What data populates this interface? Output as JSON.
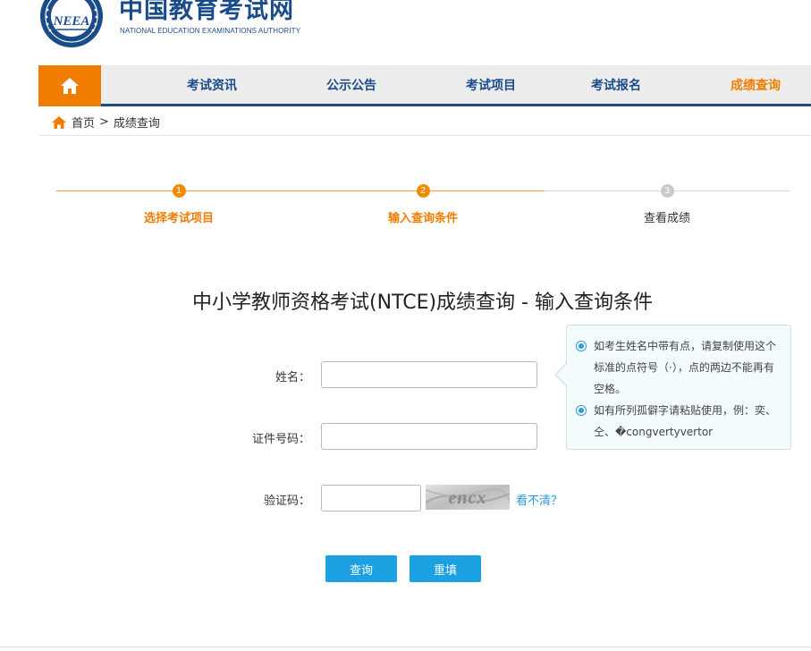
{
  "header": {
    "logo_title": "中国教育考试网",
    "logo_subtitle": "NATIONAL EDUCATION EXAMINATIONS AUTHORITY",
    "emblem_text": "NEEA"
  },
  "nav": {
    "home_icon": "home-icon",
    "items": [
      {
        "label": "考试资讯",
        "active": false
      },
      {
        "label": "公示公告",
        "active": false
      },
      {
        "label": "考试项目",
        "active": false
      },
      {
        "label": "考试报名",
        "active": false
      },
      {
        "label": "成绩查询",
        "active": true
      }
    ]
  },
  "breadcrumb": {
    "home": "首页",
    "separator": ">",
    "current": "成绩查询"
  },
  "steps": [
    {
      "number": "1",
      "label": "选择考试项目",
      "state": "done"
    },
    {
      "number": "2",
      "label": "输入查询条件",
      "state": "current"
    },
    {
      "number": "3",
      "label": "查看成绩",
      "state": "pending"
    }
  ],
  "page_title": "中小学教师资格考试(NTCE)成绩查询 - 输入查询条件",
  "form": {
    "name_label": "姓名：",
    "name_value": "",
    "id_label": "证件号码：",
    "id_value": "",
    "captcha_label": "验证码：",
    "captcha_value": "",
    "captcha_text": "encx",
    "captcha_refresh": "看不清？",
    "submit_label": "查询",
    "reset_label": "重填"
  },
  "tips": [
    "如考生姓名中带有点，请复制使用这个标准的点符号（·），点的两边不能再有空格。",
    "如有所列孤僻字请粘贴使用，例：奕、仝、�congvertyvertor"
  ],
  "colors": {
    "brand_blue": "#1a4c8b",
    "accent_orange": "#f07c00",
    "button_blue": "#1ba1e2",
    "link_blue": "#2a9bd8"
  }
}
